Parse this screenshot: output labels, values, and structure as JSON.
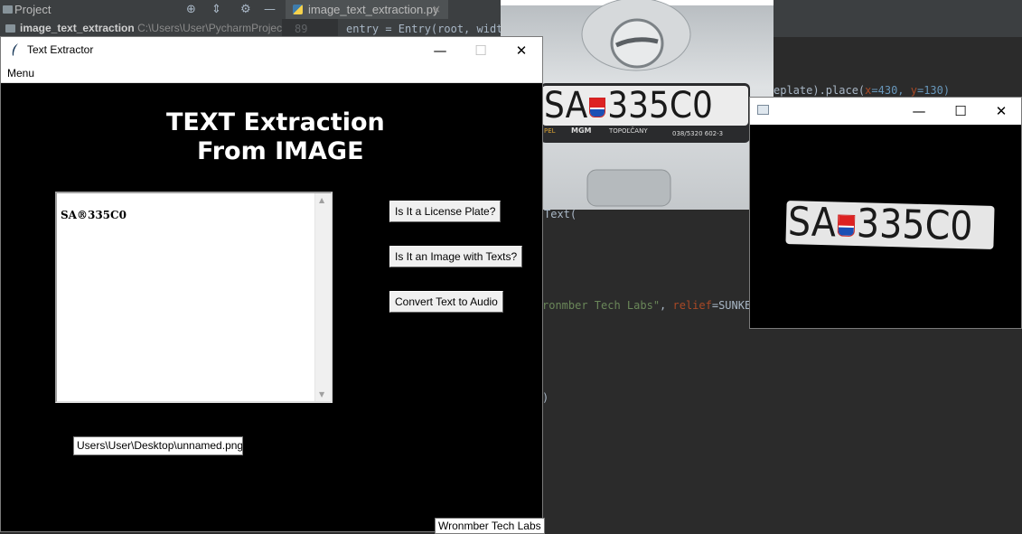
{
  "ide": {
    "project_label": "Project",
    "tab_label": "image_text_extraction.py",
    "tab_close": "×",
    "project_root_name": "image_text_extraction",
    "project_root_path": "C:\\Users\\User\\PycharmProjec",
    "line_number": "89",
    "code_line_entry": "entry = Entry(root, width",
    "code_fragment_place_pre": "eplate).place(",
    "code_fragment_place_x": "x",
    "code_fragment_place_xv": "=430, ",
    "code_fragment_place_y": "y",
    "code_fragment_place_yv": "=130)",
    "code_fragment_text": "Text(",
    "code_fragment_label_str": "ronmber Tech Labs\"",
    "code_fragment_label_rest": ", ",
    "code_fragment_relief": "relief",
    "code_fragment_relief_val": "=SUNKEN",
    "code_fragment_paren": ")"
  },
  "text_extractor": {
    "title": "Text Extractor",
    "menu_label": "Menu",
    "heading_line1": "TEXT Extraction",
    "heading_line2": "From IMAGE",
    "extracted_text": "SA®335C0",
    "btn_license_plate": "Is It a License Plate?",
    "btn_image_texts": "Is It an Image with Texts?",
    "btn_text_to_audio": "Convert Text to Audio",
    "path_value": "Users\\User\\Desktop\\unnamed.png",
    "credit": "Wronmber Tech Labs"
  },
  "car_photo": {
    "plate_left": "SA",
    "plate_right": "335C0",
    "dealer_text_left": "PEL",
    "dealer_text_mgm": "MGM",
    "dealer_text_city": "TOPOĽČANY",
    "dealer_text_phone": "038/5320 602-3"
  },
  "plate_window": {
    "plate_left": "SA",
    "plate_right": "335C0"
  },
  "window_controls": {
    "minimize": "—",
    "maximize": "☐",
    "close": "✕"
  },
  "colors": {
    "ide_bg": "#2b2b2b",
    "ide_toolbar": "#3c3f41",
    "app_bg": "#000000",
    "button_bg": "#f0f0f0",
    "accent_tab": "#4a88c7"
  }
}
